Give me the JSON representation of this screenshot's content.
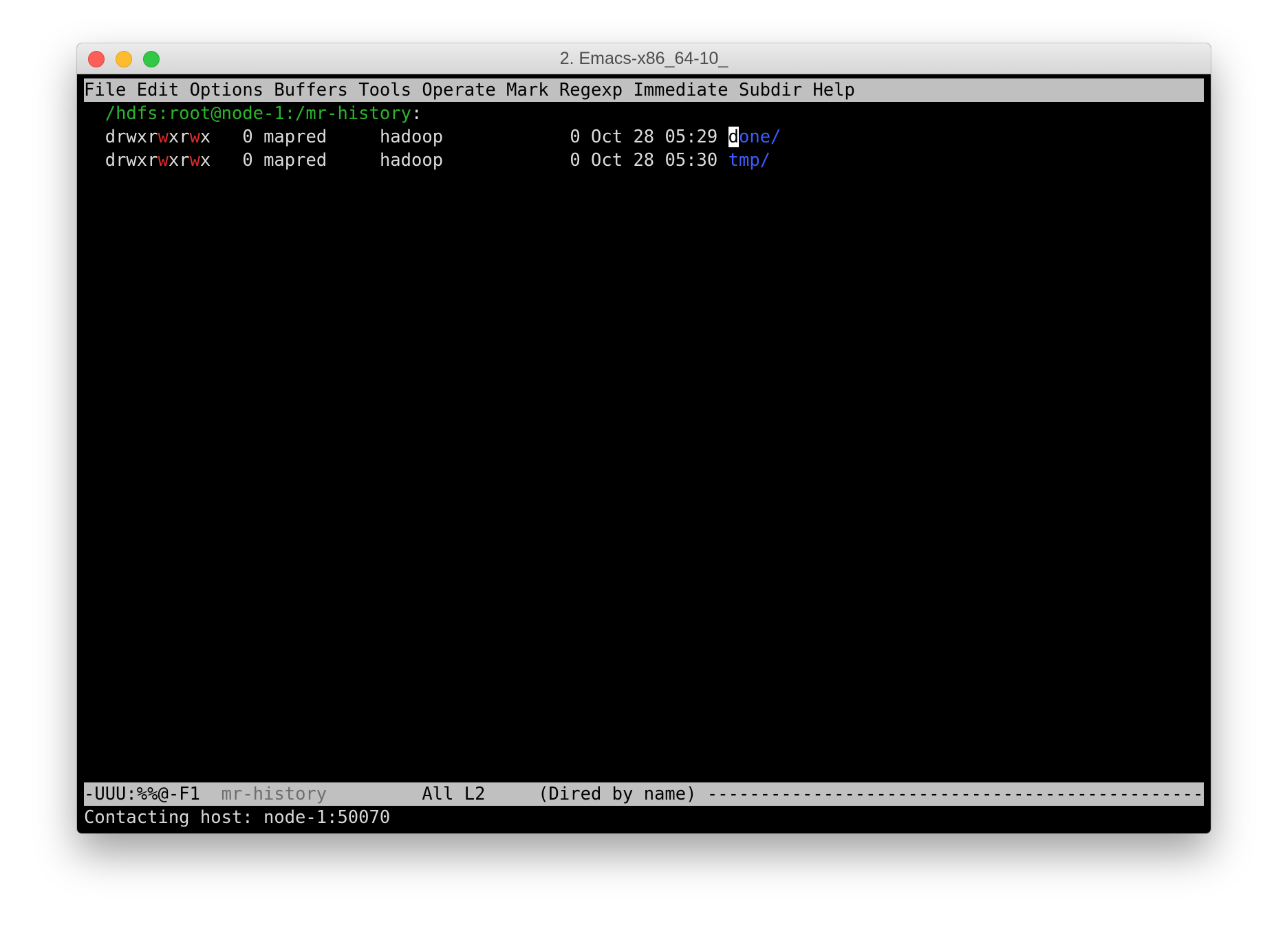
{
  "window": {
    "title": "2. Emacs-x86_64-10_"
  },
  "menubar": {
    "items": [
      "File",
      "Edit",
      "Options",
      "Buffers",
      "Tools",
      "Operate",
      "Mark",
      "Regexp",
      "Immediate",
      "Subdir",
      "Help"
    ]
  },
  "dired": {
    "header_path": "/hdfs:root@node-1:/mr-history",
    "header_colon": ":",
    "entries": [
      {
        "perm_a": "drwxr",
        "perm_b": "w",
        "perm_c": "xr",
        "perm_d": "w",
        "perm_e": "x",
        "links": "0",
        "owner": "mapred",
        "group": "hadoop",
        "size": "0",
        "date": "Oct 28 05:29",
        "name_cursor_char": "d",
        "name_rest": "one/"
      },
      {
        "perm_a": "drwxr",
        "perm_b": "w",
        "perm_c": "xr",
        "perm_d": "w",
        "perm_e": "x",
        "links": "0",
        "owner": "mapred",
        "group": "hadoop",
        "size": "0",
        "date": "Oct 28 05:30",
        "name": "tmp/"
      }
    ]
  },
  "modeline": {
    "status": "-UUU:%%@-F1",
    "buffer_name": "mr-history",
    "position": "All L2",
    "mode": "(Dired by name)",
    "filler": "-------------------------------------------------------"
  },
  "echo_area": {
    "message": "Contacting host: node-1:50070"
  },
  "colors": {
    "directory": "#3c5cff",
    "header_path": "#2bb52b",
    "writable_perm": "#e02a2a",
    "bar_background": "#c0c0c0"
  }
}
